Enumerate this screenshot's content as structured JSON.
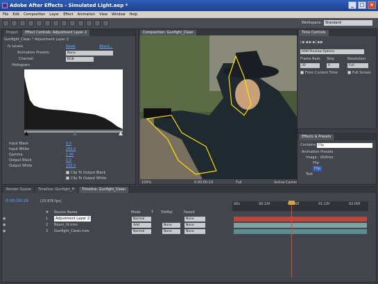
{
  "window": {
    "title": "Adobe After Effects - Simulated Light.aep *"
  },
  "menu": [
    "File",
    "Edit",
    "Composition",
    "Layer",
    "Effect",
    "Animation",
    "View",
    "Window",
    "Help"
  ],
  "workspace": {
    "label": "Workspace:",
    "value": "Standard"
  },
  "left_panel": {
    "tabs": [
      "Project",
      "Effect Controls: Adjustment Layer 2"
    ],
    "subtitle": "Gunfight_Clean * Adjustment Layer 2",
    "effect_name": "Levels",
    "reset": "Reset",
    "about": "About...",
    "animation_presets_label": "Animation Presets:",
    "animation_presets_value": "None",
    "channel_label": "Channel:",
    "channel_value": "RGB",
    "histogram_label": "Histogram",
    "params": [
      {
        "label": "Input Black",
        "value": "0.0"
      },
      {
        "label": "Input White",
        "value": "255.0"
      },
      {
        "label": "Gamma",
        "value": "1.00"
      },
      {
        "label": "Output Black",
        "value": "0.0"
      },
      {
        "label": "Output White",
        "value": "255.0"
      }
    ],
    "checks": [
      "Clip To Output Black",
      "Clip To Output White"
    ]
  },
  "comp_panel": {
    "tab": "Composition: Gunfight_Clean",
    "zoom": "100%",
    "timecode": "0:00:00:19",
    "res": "Full",
    "view": "Active Camera"
  },
  "time_controls": {
    "tab": "Time Controls",
    "ram_preview": "RAM Preview Options",
    "frame_rate_label": "Frame Rate",
    "frame_rate_value": "30",
    "skip_label": "Skip",
    "skip_value": "0",
    "resolution_label": "Resolution",
    "resolution_value": "Full",
    "from_current": "From Current Time",
    "full_screen": "Full Screen"
  },
  "effects_presets": {
    "tab": "Effects & Presets",
    "contains_label": "Contains:",
    "contains_value": "Flip",
    "tree": [
      "Animation Presets",
      "Image - Utilities",
      "Flip",
      "Flip",
      "Text"
    ]
  },
  "timeline": {
    "tabs": [
      "Render Queue",
      "Timeline: Gunfight_Fr",
      "Timeline: Gunfight_Clean"
    ],
    "timecode": "0:00:00:19",
    "fps": "(23.976 fps)",
    "columns": [
      "#",
      "Source Name",
      "Mode",
      "T",
      "TrkMat",
      "Parent"
    ],
    "layers": [
      {
        "num": "1",
        "name": "Adjustment Layer 2",
        "mode": "Normal",
        "trkmat": "",
        "parent": "None",
        "color": "#c1463a"
      },
      {
        "num": "2",
        "name": "Beam_lit.mov",
        "mode": "Add",
        "trkmat": "None",
        "parent": "None",
        "color": "#7fa3a5"
      },
      {
        "num": "3",
        "name": "Gunfight_Clean.mov",
        "mode": "Normal",
        "trkmat": "None",
        "parent": "None",
        "color": "#5d8e8f"
      }
    ],
    "ruler_labels": [
      "00s",
      "00:15f",
      "01:00f",
      "01:15f",
      "02:00f"
    ]
  },
  "icons": [
    "app-icon",
    "minimize-icon",
    "maximize-icon",
    "close-icon",
    "selection-tool-icon",
    "hand-tool-icon",
    "zoom-tool-icon",
    "rotate-tool-icon",
    "camera-tool-icon",
    "pan-behind-icon",
    "mask-tool-icon",
    "pen-tool-icon",
    "text-tool-icon",
    "brush-tool-icon",
    "clone-tool-icon",
    "eraser-tool-icon",
    "puppet-tool-icon"
  ],
  "colors": {
    "accent": "#6aa7ff",
    "titlebar": "#2f5fb8",
    "playhead": "#e0443a"
  }
}
